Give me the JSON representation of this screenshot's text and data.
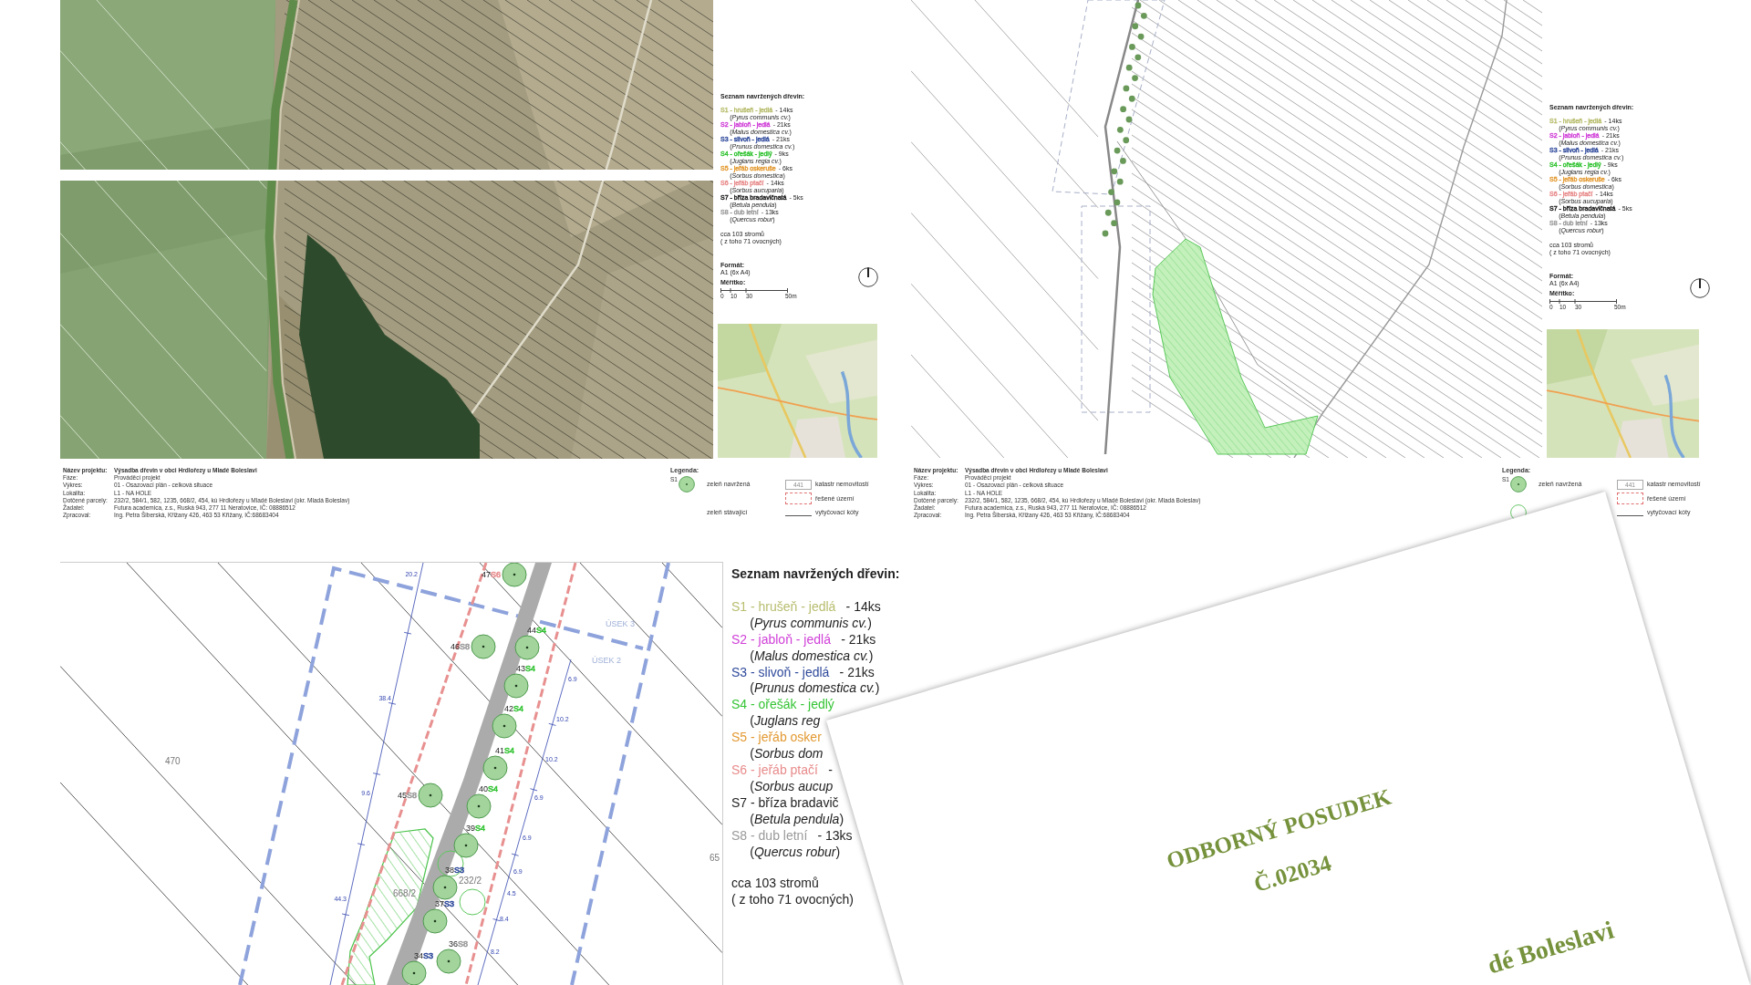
{
  "overview_sheets": [
    {
      "kind": "aerial",
      "species_list": {
        "title": "Seznam navržených dřevin:",
        "species": [
          {
            "label": "S1 - hrušeň - jedlá",
            "count": "- 14ks",
            "latin": "(*Pyrus communis cv.*)",
            "color": "#b8bd6e"
          },
          {
            "label": "S2 - jabloň - jedlá",
            "count": "- 21ks",
            "latin": "(*Malus domestica cv.*)",
            "color": "#d040d8"
          },
          {
            "label": "S3 - slivoň - jedlá",
            "count": "- 21ks",
            "latin": "(*Prunus domestica cv.*)",
            "color": "#2f4a9b"
          },
          {
            "label": "S4 - ořešák - jedlý",
            "count": "- 9ks",
            "latin": "(*Juglans regia cv.*)",
            "color": "#35c435"
          },
          {
            "label": "S5 - jeřáb oskeruše",
            "count": "- 6ks",
            "latin": "(*Sorbus domestica*)",
            "color": "#e39a33"
          },
          {
            "label": "S6 - jeřáb ptačí",
            "count": "- 14ks",
            "latin": "(*Sorbus aucuparia*)",
            "color": "#e88b8b"
          },
          {
            "label": "S7 - bříza bradavičnatá",
            "count": "- 5ks",
            "latin": "(*Betula pendula*)",
            "color": "#1e1e1e"
          },
          {
            "label": "S8 - dub letní",
            "count": "- 13ks",
            "latin": "(*Quercus robur*)",
            "color": "#9a9a9a"
          }
        ],
        "summary": [
          "cca 103 stromů",
          "( z toho 71 ovocných)"
        ]
      },
      "format": {
        "label": "Formát:",
        "value": "A1 (6x A4)"
      },
      "scale": {
        "label": "Měřítko:",
        "ticks": [
          "0",
          "10",
          "30",
          "50m"
        ]
      },
      "info": [
        {
          "label": "Název projektu:",
          "value": "Výsadba dřevin v obci Hrdlořezy u Mladé Boleslavi"
        },
        {
          "label": "Fáze:",
          "value": "Prováděcí projekt"
        },
        {
          "label": "Výkres:",
          "value": "01 - Osazovací plán - celková situace"
        },
        {
          "label": "Lokalita:",
          "value": "L1 - NA HOLE"
        },
        {
          "label": "Dotčené parcely:",
          "value": "232/2, 584/1, 582, 1235, 668/2, 454, kú Hrdlořezy u Mladé Boleslavi (okr. Mladá Boleslav)"
        },
        {
          "label": "Žadatel:",
          "value": "Futura academica, z.s., Ruská 943, 277 11 Neratovice, IČ: 08886512"
        },
        {
          "label": "Zpracoval:",
          "value": "Ing. Petra Šiberská, Křižany 426, 463 53 Křižany, IČ:68683404"
        }
      ],
      "legend": {
        "title": "Legenda:",
        "items": [
          {
            "kind": "proposed_tree",
            "code": "S1",
            "label": "zeleň navržená"
          },
          {
            "kind": "existing_tree",
            "symbol": false,
            "label": "zeleň stávající"
          },
          {
            "kind": "parcel",
            "code": "441",
            "label": "katastr nemovitostí"
          },
          {
            "kind": "area",
            "label": "řešené území"
          },
          {
            "kind": "dimension",
            "label": "vytyčovací kóty"
          }
        ]
      }
    },
    {
      "kind": "line_map",
      "species_list": {
        "title": "Seznam navržených dřevin:",
        "species": [
          {
            "label": "S1 - hrušeň - jedlá",
            "count": "- 14ks",
            "latin": "(*Pyrus communis cv.*)",
            "color": "#b8bd6e"
          },
          {
            "label": "S2 - jabloň - jedlá",
            "count": "- 21ks",
            "latin": "(*Malus domestica cv.*)",
            "color": "#d040d8"
          },
          {
            "label": "S3 - slivoň - jedlá",
            "count": "- 21ks",
            "latin": "(*Prunus domestica cv.*)",
            "color": "#2f4a9b"
          },
          {
            "label": "S4 - ořešák - jedlý",
            "count": "- 9ks",
            "latin": "(*Juglans regia cv.*)",
            "color": "#35c435"
          },
          {
            "label": "S5 - jeřáb oskeruše",
            "count": "- 6ks",
            "latin": "(*Sorbus domestica*)",
            "color": "#e39a33"
          },
          {
            "label": "S6 - jeřáb ptačí",
            "count": "- 14ks",
            "latin": "(*Sorbus aucuparia*)",
            "color": "#e88b8b"
          },
          {
            "label": "S7 - bříza bradavičnatá",
            "count": "- 5ks",
            "latin": "(*Betula pendula*)",
            "color": "#1e1e1e"
          },
          {
            "label": "S8 - dub letní",
            "count": "- 13ks",
            "latin": "(*Quercus robur*)",
            "color": "#9a9a9a"
          }
        ],
        "summary": [
          "cca 103 stromů",
          "( z toho 71 ovocných)"
        ]
      },
      "format": {
        "label": "Formát:",
        "value": "A1 (6x A4)"
      },
      "scale": {
        "label": "Měřítko:",
        "ticks": [
          "0",
          "10",
          "30",
          "50m"
        ]
      },
      "info": [
        {
          "label": "Název projektu:",
          "value": "Výsadba dřevin v obci Hrdlořezy u Mladé Boleslavi"
        },
        {
          "label": "Fáze:",
          "value": "Prováděcí projekt"
        },
        {
          "label": "Výkres:",
          "value": "01 - Osazovací plán - celková situace"
        },
        {
          "label": "Lokalita:",
          "value": "L1 - NA HOLE"
        },
        {
          "label": "Dotčené parcely:",
          "value": "232/2, 584/1, 582, 1235, 668/2, 454, kú Hrdlořezy u Mladé Boleslavi (okr. Mladá Boleslav)"
        },
        {
          "label": "Žadatel:",
          "value": "Futura academica, z.s., Ruská 943, 277 11 Neratovice, IČ: 08886512"
        },
        {
          "label": "Zpracoval:",
          "value": "Ing. Petra Šiberská, Křižany 426, 463 53 Křižany, IČ:68683404"
        }
      ],
      "legend": {
        "title": "Legenda:",
        "items": [
          {
            "kind": "proposed_tree",
            "code": "S1",
            "label": "zeleň navržená"
          },
          {
            "kind": "existing_tree",
            "symbol": true
          },
          {
            "kind": "parcel",
            "code": "441",
            "label": "katastr nemovitostí"
          },
          {
            "kind": "area",
            "label": "řešené území"
          },
          {
            "kind": "dimension",
            "label": "vytyčovací kóty"
          }
        ]
      }
    }
  ],
  "detail_sheet": {
    "map": {
      "trees": [
        {
          "number": "47",
          "code": "S6",
          "color": "#e88b8b"
        },
        {
          "number": "46",
          "code": "S8",
          "color": "#9a9a9a"
        },
        {
          "number": "44",
          "code": "S4",
          "color": "#35c435"
        },
        {
          "number": "43",
          "code": "S4",
          "color": "#35c435"
        },
        {
          "number": "42",
          "code": "S4",
          "color": "#35c435"
        },
        {
          "number": "41",
          "code": "S4",
          "color": "#35c435"
        },
        {
          "number": "45",
          "code": "S8",
          "color": "#9a9a9a"
        },
        {
          "number": "40",
          "code": "S4",
          "color": "#35c435"
        },
        {
          "number": "39",
          "code": "S4",
          "color": "#35c435"
        },
        {
          "number": "38",
          "code": "S3",
          "color": "#2f4a9b"
        },
        {
          "number": "37",
          "code": "S3",
          "color": "#2f4a9b"
        },
        {
          "number": "36",
          "code": "S8",
          "color": "#9a9a9a"
        },
        {
          "number": "34",
          "code": "S3",
          "color": "#2f4a9b"
        }
      ],
      "labels": [
        {
          "kind": "parcel",
          "text": "470"
        },
        {
          "kind": "section",
          "text": "ÚSEK 3"
        },
        {
          "kind": "section",
          "text": "ÚSEK 2"
        },
        {
          "kind": "parcel",
          "text": "232/2"
        },
        {
          "kind": "parcel",
          "text": "668/2"
        },
        {
          "kind": "parcel",
          "text": "65"
        },
        {
          "kind": "dimension",
          "text": "20.2"
        },
        {
          "kind": "dimension",
          "text": "38.4"
        },
        {
          "kind": "dimension",
          "text": "9.6"
        },
        {
          "kind": "dimension",
          "text": "44.3"
        },
        {
          "kind": "dimension",
          "text": "6.9"
        },
        {
          "kind": "dimension",
          "text": "10.2"
        },
        {
          "kind": "dimension",
          "text": "10.2"
        },
        {
          "kind": "dimension",
          "text": "6.9"
        },
        {
          "kind": "dimension",
          "text": "6.9"
        },
        {
          "kind": "dimension",
          "text": "6.9"
        },
        {
          "kind": "dimension",
          "text": "4.5"
        },
        {
          "kind": "dimension",
          "text": "8.4"
        },
        {
          "kind": "dimension",
          "text": "8.2"
        }
      ]
    },
    "species_list": {
      "title": "Seznam navržených dřevin:",
      "species": [
        {
          "label": "S1 - hrušeň - jedlá",
          "count": "- 14ks",
          "latin": "(*Pyrus communis cv.*)",
          "color": "#b8bd6e"
        },
        {
          "label": "S2 - jabloň - jedlá",
          "count": "- 21ks",
          "latin": "(*Malus domestica cv.*)",
          "color": "#d040d8"
        },
        {
          "label": "S3 - slivoň - jedlá",
          "count": "- 21ks",
          "latin": "(*Prunus domestica cv.*)",
          "color": "#2f4a9b"
        },
        {
          "label": "S4 - ořešák - jedlý",
          "latin": "(*Juglans reg*",
          "color": "#35c435"
        },
        {
          "label": "S5 - jeřáb osker",
          "latin": "(*Sorbus dom*",
          "color": "#e39a33"
        },
        {
          "label": "S6 - jeřáb ptačí",
          "count": "-",
          "latin": "(*Sorbus aucup*",
          "color": "#e88b8b"
        },
        {
          "label": "S7 - bříza bradavič",
          "latin": "(*Betula pendula*)",
          "color": "#1e1e1e"
        },
        {
          "label": "S8 - dub letní",
          "count": "- 13ks",
          "latin": "(*Quercus robur*)",
          "color": "#9a9a9a"
        }
      ],
      "summary": [
        "cca 103 stromů",
        "( z toho 71 ovocných)"
      ]
    }
  },
  "cover_page": {
    "title": "ODBORNÝ POSUDEK",
    "number": "Č.02034",
    "place": "dé Boleslavi"
  }
}
